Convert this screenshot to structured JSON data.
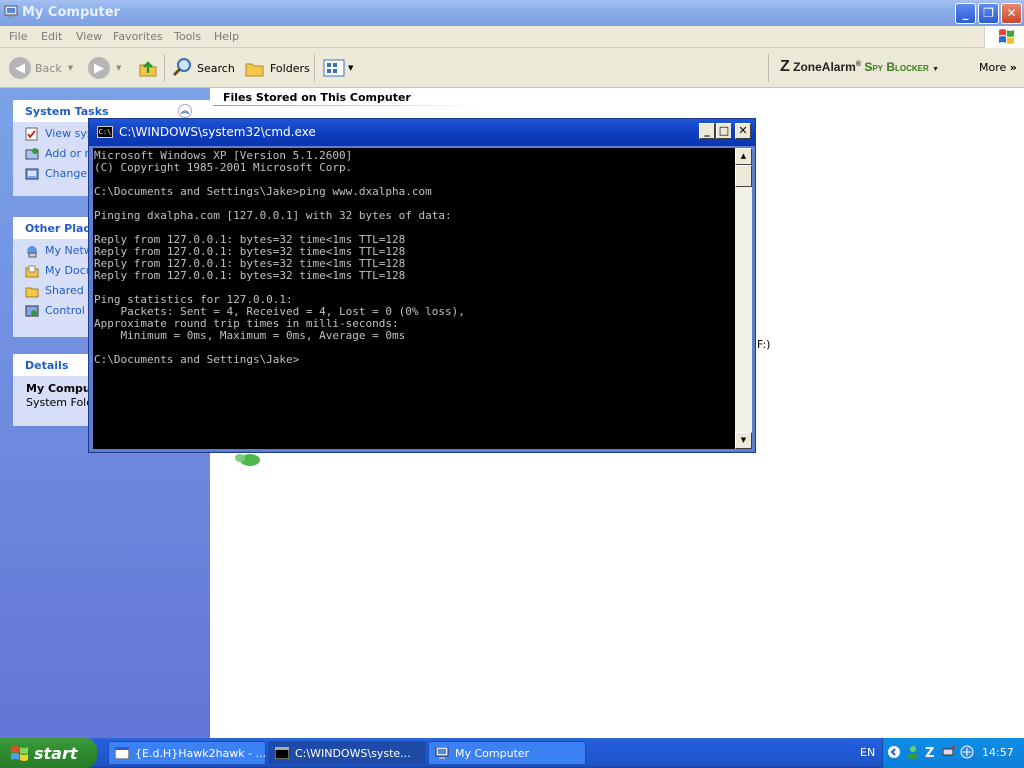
{
  "explorer": {
    "title": "My Computer",
    "menu": [
      "File",
      "Edit",
      "View",
      "Favorites",
      "Tools",
      "Help"
    ],
    "toolbar": {
      "back": "Back",
      "search": "Search",
      "folders": "Folders",
      "more": "More",
      "zonealarm_brand": "ZoneAlarm",
      "zonealarm_mark": "®",
      "zonealarm_product": "Spy Blocker"
    },
    "sections": {
      "system_tasks": {
        "title": "System Tasks",
        "items": [
          "View sys",
          "Add or r",
          "Change"
        ]
      },
      "other_places": {
        "title": "Other Place",
        "items": [
          "My Netw",
          "My Docu",
          "Shared I",
          "Control I"
        ]
      },
      "details": {
        "title": "Details",
        "name": "My Comput",
        "type": "System Folde"
      }
    },
    "content_heading": "Files Stored on This Computer",
    "peek_text": "F:)"
  },
  "cmd": {
    "title": "C:\\WINDOWS\\system32\\cmd.exe",
    "icon_text": "C:\\",
    "lines": [
      "Microsoft Windows XP [Version 5.1.2600]",
      "(C) Copyright 1985-2001 Microsoft Corp.",
      "",
      "C:\\Documents and Settings\\Jake>ping www.dxalpha.com",
      "",
      "Pinging dxalpha.com [127.0.0.1] with 32 bytes of data:",
      "",
      "Reply from 127.0.0.1: bytes=32 time<1ms TTL=128",
      "Reply from 127.0.0.1: bytes=32 time<1ms TTL=128",
      "Reply from 127.0.0.1: bytes=32 time<1ms TTL=128",
      "Reply from 127.0.0.1: bytes=32 time<1ms TTL=128",
      "",
      "Ping statistics for 127.0.0.1:",
      "    Packets: Sent = 4, Received = 4, Lost = 0 (0% loss),",
      "Approximate round trip times in milli-seconds:",
      "    Minimum = 0ms, Maximum = 0ms, Average = 0ms",
      "",
      "C:\\Documents and Settings\\Jake>"
    ]
  },
  "taskbar": {
    "start": "start",
    "tasks": [
      "{E.d.H}Hawk2hawk - ...",
      "C:\\WINDOWS\\syste...",
      "My Computer"
    ],
    "language": "EN",
    "clock": "14:57"
  },
  "colors": {
    "xp_blue": "#0a36b0",
    "taskpane_link": "#215dc6",
    "start_green": "#2e8b2e",
    "console_text": "#c0c0c0"
  }
}
